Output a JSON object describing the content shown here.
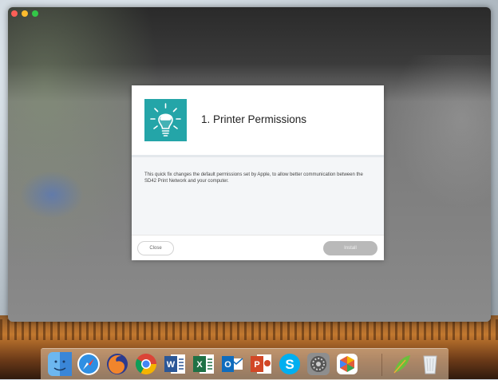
{
  "dialog": {
    "title": "1. Printer Permissions",
    "description": "This quick fix changes the default permissions set by Apple, to allow better communication between the SD42 Print Network and your computer.",
    "close_label": "Close",
    "install_label": "Install"
  },
  "colors": {
    "icon_bg": "#24a5a8",
    "install_disabled": "#b9b9b9"
  },
  "dock": {
    "items": [
      {
        "name": "finder-icon",
        "color": "#3b8de0"
      },
      {
        "name": "safari-icon",
        "color": "#2f8fe3"
      },
      {
        "name": "firefox-icon",
        "color": "#e8702a"
      },
      {
        "name": "chrome-icon",
        "color": "#3aa757"
      },
      {
        "name": "word-icon",
        "color": "#2b5797"
      },
      {
        "name": "excel-icon",
        "color": "#1e7145"
      },
      {
        "name": "outlook-icon",
        "color": "#0f6cbd"
      },
      {
        "name": "powerpoint-icon",
        "color": "#d24726"
      },
      {
        "name": "skype-icon",
        "color": "#00aff0"
      },
      {
        "name": "system-preferences-icon",
        "color": "#7d7d7d"
      },
      {
        "name": "self-service-icon",
        "color": "#e15d3a"
      },
      {
        "name": "feather-app-icon",
        "color": "#5cb85c"
      },
      {
        "name": "trash-icon",
        "color": "#d9dde0"
      }
    ]
  }
}
